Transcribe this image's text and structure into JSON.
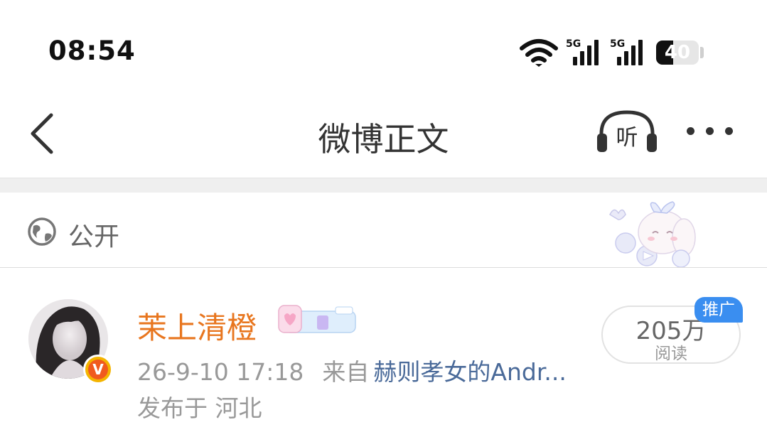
{
  "status_bar": {
    "time": "08:54",
    "signal1_label": "5G",
    "signal2_label": "5G",
    "battery": "40",
    "battery_level": 0.4
  },
  "nav": {
    "title": "微博正文",
    "back_icon": "chevron-left-icon",
    "listen_icon": "headphones-icon",
    "listen_label": "听",
    "more_icon": "more-horizontal-icon"
  },
  "visibility": {
    "icon": "globe-icon",
    "label": "公开"
  },
  "author": {
    "name": "茉上清橙",
    "verified_badge": "V",
    "timestamp": "26-9-10 17:18",
    "source_prefix": "来自",
    "source": "赫则孝女的Andr...",
    "location": "发布于 河北"
  },
  "reads": {
    "count": "205万",
    "label": "阅读",
    "promo_tag": "推广"
  },
  "colors": {
    "username": "#e8761f",
    "source_link": "#4a6a99",
    "promo": "#3a8ef0",
    "badge": "#f05a1e"
  }
}
